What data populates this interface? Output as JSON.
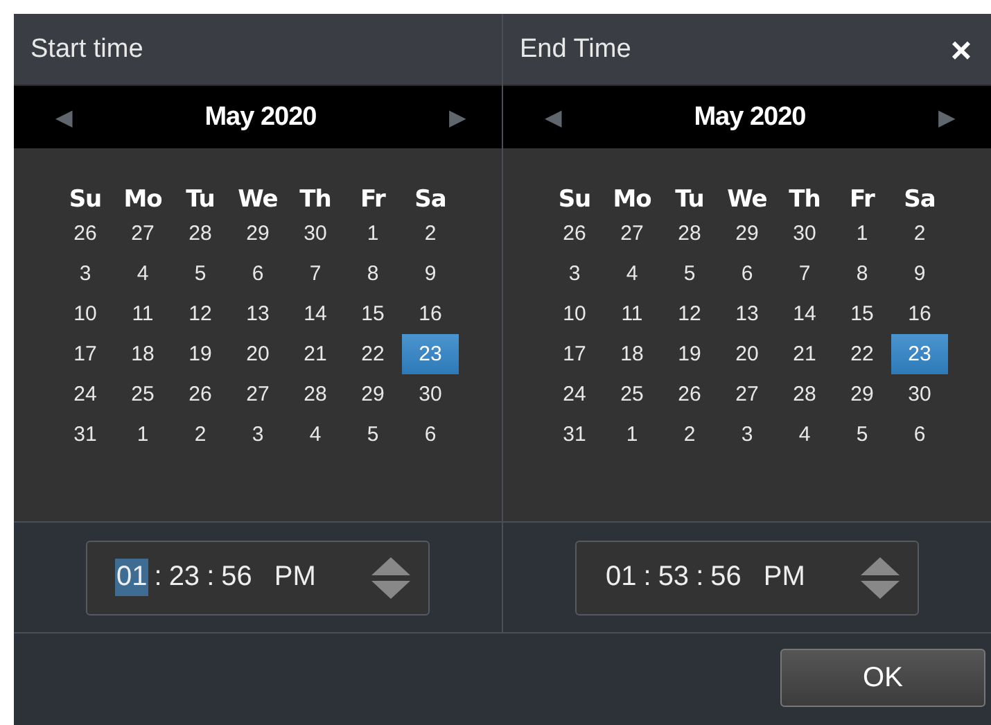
{
  "close_label": "×",
  "panels": [
    {
      "title": "Start time",
      "month": "May 2020",
      "prev": "◀",
      "next": "▶",
      "weekdays": [
        "Su",
        "Mo",
        "Tu",
        "We",
        "Th",
        "Fr",
        "Sa"
      ],
      "days": [
        {
          "label": "26",
          "selected": false
        },
        {
          "label": "27",
          "selected": false
        },
        {
          "label": "28",
          "selected": false
        },
        {
          "label": "29",
          "selected": false
        },
        {
          "label": "30",
          "selected": false
        },
        {
          "label": "1",
          "selected": false
        },
        {
          "label": "2",
          "selected": false
        },
        {
          "label": "3",
          "selected": false
        },
        {
          "label": "4",
          "selected": false
        },
        {
          "label": "5",
          "selected": false
        },
        {
          "label": "6",
          "selected": false
        },
        {
          "label": "7",
          "selected": false
        },
        {
          "label": "8",
          "selected": false
        },
        {
          "label": "9",
          "selected": false
        },
        {
          "label": "10",
          "selected": false
        },
        {
          "label": "11",
          "selected": false
        },
        {
          "label": "12",
          "selected": false
        },
        {
          "label": "13",
          "selected": false
        },
        {
          "label": "14",
          "selected": false
        },
        {
          "label": "15",
          "selected": false
        },
        {
          "label": "16",
          "selected": false
        },
        {
          "label": "17",
          "selected": false
        },
        {
          "label": "18",
          "selected": false
        },
        {
          "label": "19",
          "selected": false
        },
        {
          "label": "20",
          "selected": false
        },
        {
          "label": "21",
          "selected": false
        },
        {
          "label": "22",
          "selected": false
        },
        {
          "label": "23",
          "selected": true
        },
        {
          "label": "24",
          "selected": false
        },
        {
          "label": "25",
          "selected": false
        },
        {
          "label": "26",
          "selected": false
        },
        {
          "label": "27",
          "selected": false
        },
        {
          "label": "28",
          "selected": false
        },
        {
          "label": "29",
          "selected": false
        },
        {
          "label": "30",
          "selected": false
        },
        {
          "label": "31",
          "selected": false
        },
        {
          "label": "1",
          "selected": false
        },
        {
          "label": "2",
          "selected": false
        },
        {
          "label": "3",
          "selected": false
        },
        {
          "label": "4",
          "selected": false
        },
        {
          "label": "5",
          "selected": false
        },
        {
          "label": "6",
          "selected": false
        }
      ],
      "time": [
        {
          "kind": "segment",
          "text": "01",
          "selected": true
        },
        {
          "kind": "separator",
          "text": ":"
        },
        {
          "kind": "segment",
          "text": "23",
          "selected": false
        },
        {
          "kind": "separator",
          "text": ":"
        },
        {
          "kind": "segment",
          "text": "56",
          "selected": false
        },
        {
          "kind": "segment",
          "text": "PM",
          "selected": false
        }
      ]
    },
    {
      "title": "End Time",
      "month": "May 2020",
      "prev": "◀",
      "next": "▶",
      "weekdays": [
        "Su",
        "Mo",
        "Tu",
        "We",
        "Th",
        "Fr",
        "Sa"
      ],
      "days": [
        {
          "label": "26",
          "selected": false
        },
        {
          "label": "27",
          "selected": false
        },
        {
          "label": "28",
          "selected": false
        },
        {
          "label": "29",
          "selected": false
        },
        {
          "label": "30",
          "selected": false
        },
        {
          "label": "1",
          "selected": false
        },
        {
          "label": "2",
          "selected": false
        },
        {
          "label": "3",
          "selected": false
        },
        {
          "label": "4",
          "selected": false
        },
        {
          "label": "5",
          "selected": false
        },
        {
          "label": "6",
          "selected": false
        },
        {
          "label": "7",
          "selected": false
        },
        {
          "label": "8",
          "selected": false
        },
        {
          "label": "9",
          "selected": false
        },
        {
          "label": "10",
          "selected": false
        },
        {
          "label": "11",
          "selected": false
        },
        {
          "label": "12",
          "selected": false
        },
        {
          "label": "13",
          "selected": false
        },
        {
          "label": "14",
          "selected": false
        },
        {
          "label": "15",
          "selected": false
        },
        {
          "label": "16",
          "selected": false
        },
        {
          "label": "17",
          "selected": false
        },
        {
          "label": "18",
          "selected": false
        },
        {
          "label": "19",
          "selected": false
        },
        {
          "label": "20",
          "selected": false
        },
        {
          "label": "21",
          "selected": false
        },
        {
          "label": "22",
          "selected": false
        },
        {
          "label": "23",
          "selected": true
        },
        {
          "label": "24",
          "selected": false
        },
        {
          "label": "25",
          "selected": false
        },
        {
          "label": "26",
          "selected": false
        },
        {
          "label": "27",
          "selected": false
        },
        {
          "label": "28",
          "selected": false
        },
        {
          "label": "29",
          "selected": false
        },
        {
          "label": "30",
          "selected": false
        },
        {
          "label": "31",
          "selected": false
        },
        {
          "label": "1",
          "selected": false
        },
        {
          "label": "2",
          "selected": false
        },
        {
          "label": "3",
          "selected": false
        },
        {
          "label": "4",
          "selected": false
        },
        {
          "label": "5",
          "selected": false
        },
        {
          "label": "6",
          "selected": false
        }
      ],
      "time": [
        {
          "kind": "segment",
          "text": "01",
          "selected": false
        },
        {
          "kind": "separator",
          "text": ":"
        },
        {
          "kind": "segment",
          "text": "53",
          "selected": false
        },
        {
          "kind": "separator",
          "text": ":"
        },
        {
          "kind": "segment",
          "text": "56",
          "selected": false
        },
        {
          "kind": "segment",
          "text": "PM",
          "selected": false
        }
      ]
    }
  ],
  "ok_button": "OK"
}
